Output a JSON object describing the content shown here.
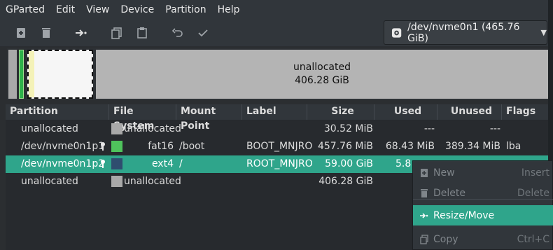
{
  "menubar": {
    "items": [
      "GParted",
      "Edit",
      "View",
      "Device",
      "Partition",
      "Help"
    ]
  },
  "toolbar": {
    "buttons": [
      "new-icon",
      "delete-icon",
      "resize-move-icon",
      "copy-icon",
      "paste-icon",
      "undo-icon",
      "apply-icon"
    ]
  },
  "device": {
    "label": "/dev/nvme0n1 (465.76 GiB)"
  },
  "graph": {
    "unallocated_label": "unallocated",
    "unallocated_size": "406.28 GiB"
  },
  "table": {
    "columns": [
      "Partition",
      "File System",
      "Mount Point",
      "Label",
      "Size",
      "Used",
      "Unused",
      "Flags"
    ],
    "rows": [
      {
        "partition": "unallocated",
        "fs": "unallocated",
        "fs_color": "#a9a9a9",
        "mount": "",
        "label": "",
        "size": "30.52 MiB",
        "used": "---",
        "unused": "---",
        "flags": "",
        "mounted": false,
        "selected": false
      },
      {
        "partition": "/dev/nvme0n1p1",
        "fs": "fat16",
        "fs_color": "#4fc35c",
        "mount": "/boot",
        "label": "BOOT_MNJRO",
        "size": "457.76 MiB",
        "used": "68.43 MiB",
        "unused": "389.34 MiB",
        "flags": "lba",
        "mounted": true,
        "selected": false
      },
      {
        "partition": "/dev/nvme0n1p2",
        "fs": "ext4",
        "fs_color": "#2f4d6f",
        "mount": "/",
        "label": "ROOT_MNJRO",
        "size": "59.00 GiB",
        "used": "5.8",
        "unused": "",
        "flags": "",
        "mounted": true,
        "selected": true
      },
      {
        "partition": "unallocated",
        "fs": "unallocated",
        "fs_color": "#a9a9a9",
        "mount": "",
        "label": "",
        "size": "406.28 GiB",
        "used": "",
        "unused": "",
        "flags": "",
        "mounted": false,
        "selected": false
      }
    ]
  },
  "context_menu": {
    "items": [
      {
        "label": "New",
        "accel": "Insert",
        "icon": "new-icon",
        "enabled": false
      },
      {
        "label": "Delete",
        "accel": "Delete",
        "icon": "delete-icon",
        "enabled": false
      },
      {
        "label": "Resize/Move",
        "accel": "",
        "icon": "resize-move-icon",
        "enabled": true,
        "highlighted": true
      },
      {
        "label": "Copy",
        "accel": "Ctrl+C",
        "icon": "copy-icon",
        "enabled": false
      }
    ]
  },
  "colors": {
    "accent": "#2fa58b",
    "background": "#2b2e31"
  }
}
